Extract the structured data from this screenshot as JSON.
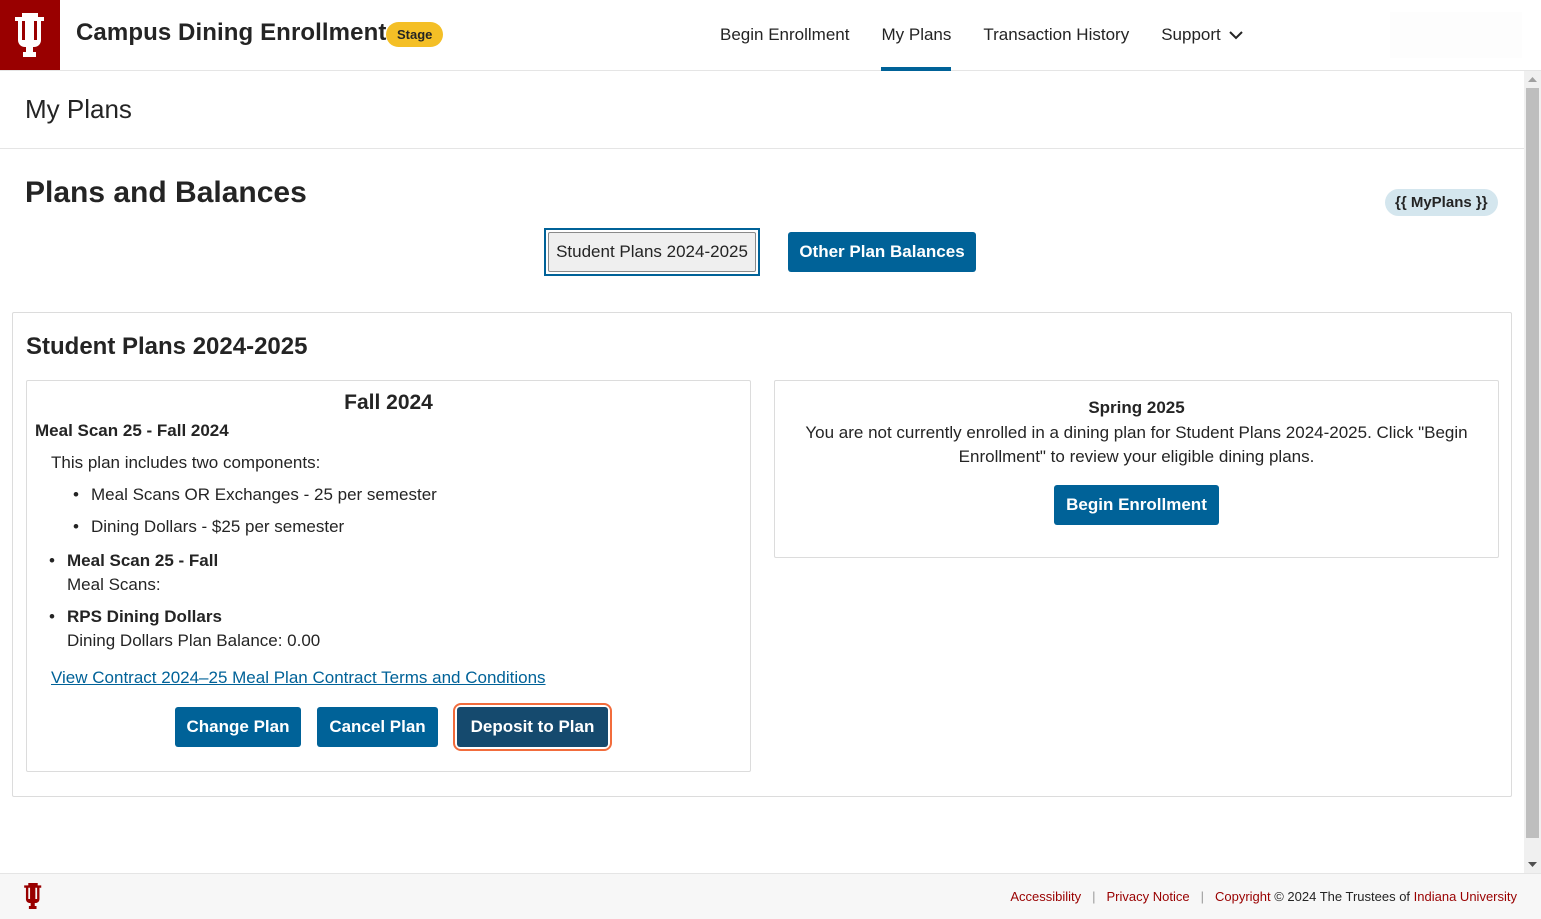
{
  "header": {
    "app_title": "Campus Dining Enrollment",
    "env_badge": "Stage",
    "logo_icon": "iu-trident-icon",
    "nav": [
      {
        "label": "Begin Enrollment",
        "active": false
      },
      {
        "label": "My Plans",
        "active": true
      },
      {
        "label": "Transaction History",
        "active": false
      },
      {
        "label": "Support",
        "active": false,
        "has_dropdown": true
      }
    ]
  },
  "page": {
    "title": "My Plans"
  },
  "main": {
    "section_title": "Plans and Balances",
    "template_badge": "{{ MyPlans }}",
    "tabs": [
      {
        "label": "Student Plans 2024-2025",
        "selected": true
      },
      {
        "label": "Other Plan Balances",
        "selected": false
      }
    ],
    "plans_card": {
      "title": "Student Plans 2024-2025",
      "fall": {
        "heading": "Fall 2024",
        "plan_name": "Meal Scan 25 - Fall 2024",
        "description": "This plan includes two components:",
        "components": [
          "Meal Scans OR Exchanges - 25 per semester",
          "Dining Dollars - $25 per semester"
        ],
        "balances": [
          {
            "name": "Meal Scan 25 - Fall",
            "detail": "Meal Scans:"
          },
          {
            "name": "RPS Dining Dollars",
            "detail": "Dining Dollars Plan Balance: 0.00"
          }
        ],
        "contract_link": "View Contract 2024–25 Meal Plan Contract Terms and Conditions",
        "buttons": {
          "change": "Change Plan",
          "cancel": "Cancel Plan",
          "deposit": "Deposit to Plan"
        }
      },
      "spring": {
        "heading": "Spring 2025",
        "message": "You are not currently enrolled in a dining plan for Student Plans 2024-2025. Click \"Begin Enrollment\" to review your eligible dining plans.",
        "button": "Begin Enrollment"
      }
    }
  },
  "footer": {
    "links": [
      "Accessibility",
      "Privacy Notice"
    ],
    "copyright_prefix": "Copyright",
    "copyright_text": " © 2024 The Trustees of ",
    "university_link": "Indiana University"
  },
  "colors": {
    "brand_crimson": "#990000",
    "primary_blue": "#006298",
    "focus_orange": "#f26c3c",
    "stage_yellow": "#f4bf26"
  }
}
